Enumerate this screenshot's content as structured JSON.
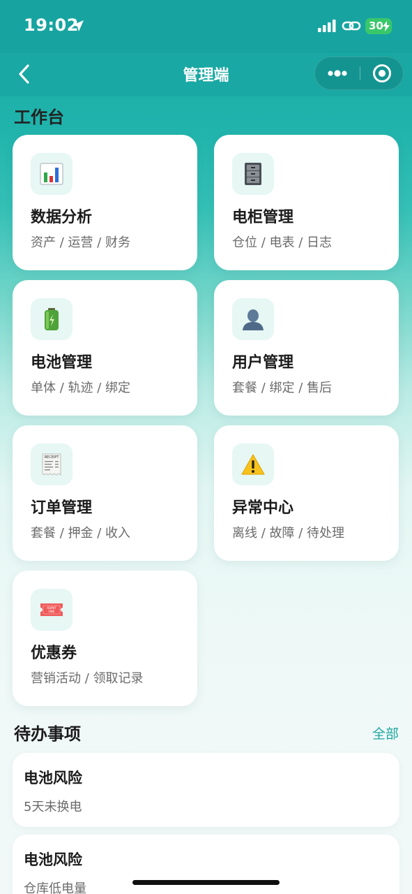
{
  "status_bar": {
    "time": "19:02",
    "battery": "30"
  },
  "nav": {
    "title": "管理端"
  },
  "workbench": {
    "title": "工作台",
    "cards": [
      {
        "title": "数据分析",
        "subtitle": "资产 / 运营 / 财务",
        "icon": "bar-chart-icon"
      },
      {
        "title": "电柜管理",
        "subtitle": "仓位 / 电表 / 日志",
        "icon": "file-cabinet-icon"
      },
      {
        "title": "电池管理",
        "subtitle": "单体 / 轨迹 / 绑定",
        "icon": "battery-icon"
      },
      {
        "title": "用户管理",
        "subtitle": "套餐 / 绑定 / 售后",
        "icon": "user-silhouette-icon"
      },
      {
        "title": "订单管理",
        "subtitle": "套餐 / 押金 / 收入",
        "icon": "receipt-icon"
      },
      {
        "title": "异常中心",
        "subtitle": "离线 / 故障 / 待处理",
        "icon": "warning-icon"
      },
      {
        "title": "优惠券",
        "subtitle": "营销活动 / 领取记录",
        "icon": "ticket-icon"
      }
    ],
    "receipt_icon_text": "RECEIPT",
    "ticket_icon_text": [
      "ADMIT",
      "ONE"
    ]
  },
  "todo": {
    "title": "待办事项",
    "all_label": "全部",
    "items": [
      {
        "title": "电池风险",
        "desc": "5天未换电"
      },
      {
        "title": "电池风险",
        "desc": "仓库低电量"
      }
    ]
  },
  "colors": {
    "accent": "#1fa7a0",
    "header": "#17a4a0",
    "battery_badge": "#39c76a"
  }
}
